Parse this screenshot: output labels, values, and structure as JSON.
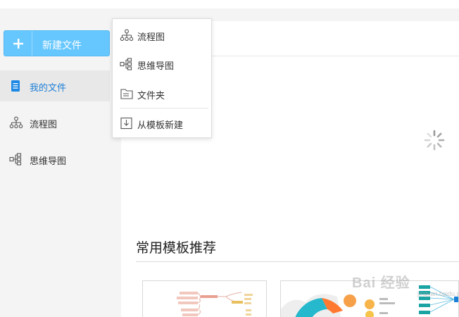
{
  "new_button": {
    "label": "新建文件"
  },
  "sidebar": {
    "items": [
      {
        "label": "我的文件",
        "icon": "document-icon",
        "active": true
      },
      {
        "label": "流程图",
        "icon": "flowchart-icon"
      },
      {
        "label": "思维导图",
        "icon": "mindmap-icon"
      }
    ]
  },
  "dropdown": {
    "items": [
      {
        "label": "流程图",
        "icon": "flowchart-icon"
      },
      {
        "label": "思维导图",
        "icon": "mindmap-icon"
      },
      {
        "label": "文件夹",
        "icon": "folder-icon"
      },
      {
        "label": "从模板新建",
        "icon": "template-import-icon"
      }
    ]
  },
  "main": {
    "loading": true,
    "templates_title": "常用模板推荐"
  },
  "watermark": {
    "text": "Bai 经验",
    "subtext": "jingyan.baidu.com"
  },
  "colors": {
    "accent": "#66c7ff",
    "active_text": "#1e7fd6"
  }
}
